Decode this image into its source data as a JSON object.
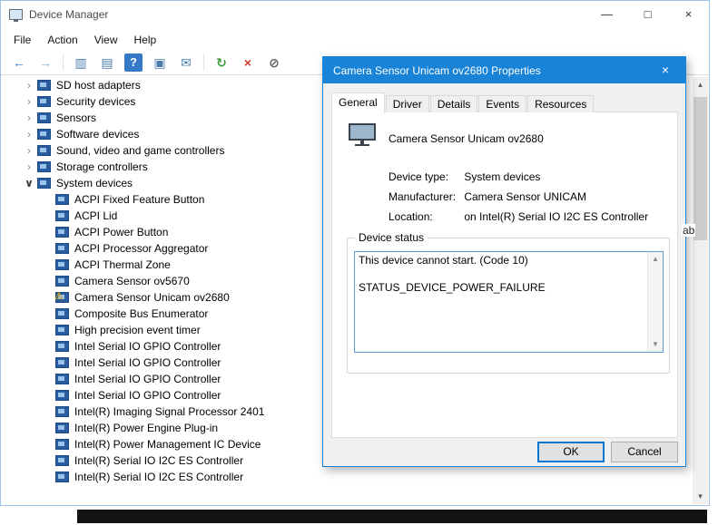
{
  "colors": {
    "accent": "#1883d7",
    "focus": "#0078d7",
    "warning": "#f3c200"
  },
  "glyphs": {
    "up": "▲",
    "down": "▼"
  },
  "window": {
    "title": "Device Manager",
    "controls": {
      "minimize": "—",
      "maximize": "□",
      "close": "×"
    }
  },
  "menu": [
    "File",
    "Action",
    "View",
    "Help"
  ],
  "toolbar": [
    {
      "name": "back",
      "glyph": "←",
      "color": "#2f7fd6"
    },
    {
      "name": "forward",
      "glyph": "→",
      "color": "#7fb0df"
    },
    {
      "type": "sep"
    },
    {
      "name": "show-console-tree",
      "glyph": "▥",
      "color": "#4a7dad"
    },
    {
      "name": "properties",
      "glyph": "▤",
      "color": "#4a7dad"
    },
    {
      "name": "help",
      "glyph": "?",
      "color": "#ffffff",
      "bg": "#3579c8"
    },
    {
      "name": "devices-by-type",
      "glyph": "▣",
      "color": "#4a7dad"
    },
    {
      "name": "support-info",
      "glyph": "✉",
      "color": "#4a7dad"
    },
    {
      "type": "sep"
    },
    {
      "name": "update-driver",
      "glyph": "↻",
      "color": "#3f9c3f"
    },
    {
      "name": "uninstall",
      "glyph": "×",
      "color": "#cf3a2c"
    },
    {
      "name": "disable",
      "glyph": "⊘",
      "color": "#5a5a5a"
    }
  ],
  "tree": {
    "chevron_collapsed": "›",
    "chevron_expanded": "∨",
    "warning_glyph": "⚠",
    "items": [
      {
        "label": "SD host adapters",
        "level": 1,
        "state": "collapsed",
        "icon": "sd-host-category-icon"
      },
      {
        "label": "Security devices",
        "level": 1,
        "state": "collapsed",
        "icon": "security-category-icon"
      },
      {
        "label": "Sensors",
        "level": 1,
        "state": "collapsed",
        "icon": "sensors-category-icon"
      },
      {
        "label": "Software devices",
        "level": 1,
        "state": "collapsed",
        "icon": "software-category-icon"
      },
      {
        "label": "Sound, video and game controllers",
        "level": 1,
        "state": "collapsed",
        "icon": "sound-category-icon"
      },
      {
        "label": "Storage controllers",
        "level": 1,
        "state": "collapsed",
        "icon": "storage-category-icon"
      },
      {
        "label": "System devices",
        "level": 1,
        "state": "expanded",
        "icon": "system-category-icon"
      },
      {
        "label": "ACPI Fixed Feature Button",
        "level": 2,
        "icon": "device-icon"
      },
      {
        "label": "ACPI Lid",
        "level": 2,
        "icon": "device-icon"
      },
      {
        "label": "ACPI Power Button",
        "level": 2,
        "icon": "device-icon"
      },
      {
        "label": "ACPI Processor Aggregator",
        "level": 2,
        "icon": "device-icon"
      },
      {
        "label": "ACPI Thermal Zone",
        "level": 2,
        "icon": "device-icon"
      },
      {
        "label": "Camera Sensor ov5670",
        "level": 2,
        "icon": "device-icon"
      },
      {
        "label": "Camera Sensor Unicam ov2680",
        "level": 2,
        "icon": "device-icon",
        "warning": true
      },
      {
        "label": "Composite Bus Enumerator",
        "level": 2,
        "icon": "device-icon"
      },
      {
        "label": "High precision event timer",
        "level": 2,
        "icon": "device-icon"
      },
      {
        "label": "Intel Serial IO GPIO Controller",
        "level": 2,
        "icon": "device-icon"
      },
      {
        "label": "Intel Serial IO GPIO Controller",
        "level": 2,
        "icon": "device-icon"
      },
      {
        "label": "Intel Serial IO GPIO Controller",
        "level": 2,
        "icon": "device-icon"
      },
      {
        "label": "Intel Serial IO GPIO Controller",
        "level": 2,
        "icon": "device-icon"
      },
      {
        "label": "Intel(R) Imaging Signal Processor 2401",
        "level": 2,
        "icon": "device-icon"
      },
      {
        "label": "Intel(R) Power Engine Plug-in",
        "level": 2,
        "icon": "device-icon"
      },
      {
        "label": "Intel(R) Power Management IC Device",
        "level": 2,
        "icon": "device-icon"
      },
      {
        "label": "Intel(R) Serial IO I2C ES Controller",
        "level": 2,
        "icon": "device-icon"
      },
      {
        "label": "Intel(R) Serial IO I2C ES Controller",
        "level": 2,
        "icon": "device-icon"
      }
    ]
  },
  "stray_text": "ab",
  "dialog": {
    "title": "Camera Sensor Unicam ov2680 Properties",
    "close_glyph": "×",
    "tabs": [
      "General",
      "Driver",
      "Details",
      "Events",
      "Resources"
    ],
    "active_tab_index": 0,
    "device_name": "Camera Sensor Unicam ov2680",
    "fields": [
      {
        "label": "Device type:",
        "value": "System devices"
      },
      {
        "label": "Manufacturer:",
        "value": "Camera Sensor UNICAM"
      },
      {
        "label": "Location:",
        "value": "on Intel(R) Serial IO I2C ES Controller"
      }
    ],
    "status": {
      "label": "Device status",
      "lines": [
        "This device cannot start. (Code 10)",
        "STATUS_DEVICE_POWER_FAILURE"
      ]
    },
    "buttons": {
      "ok": "OK",
      "cancel": "Cancel"
    }
  }
}
